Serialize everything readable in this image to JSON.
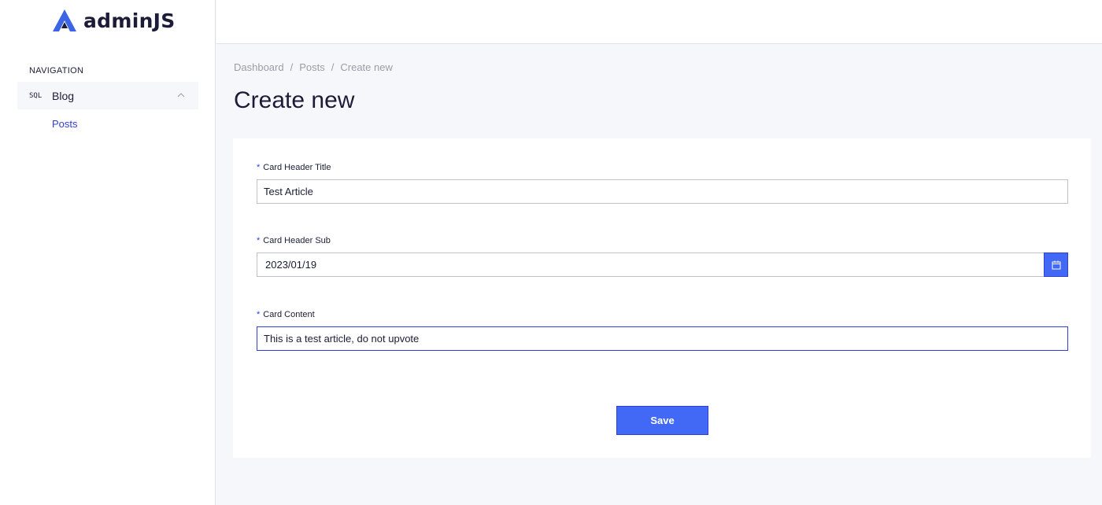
{
  "brand": {
    "name": "adminJS"
  },
  "sidebar": {
    "heading": "NAVIGATION",
    "group": {
      "db_label": "SQL",
      "label": "Blog"
    },
    "items": [
      {
        "label": "Posts"
      }
    ]
  },
  "breadcrumb": [
    "Dashboard",
    "Posts",
    "Create new"
  ],
  "page": {
    "title": "Create new"
  },
  "form": {
    "fields": [
      {
        "label": "Card Header Title",
        "value": "Test Article"
      },
      {
        "label": "Card Header Sub",
        "value": "2023/01/19"
      },
      {
        "label": "Card Content",
        "value": "This is a test article, do not upvote"
      }
    ],
    "required_marker": "*",
    "save_label": "Save"
  },
  "colors": {
    "accent": "#4268f6",
    "link": "#3040d6",
    "logo": "#3c64e4"
  }
}
